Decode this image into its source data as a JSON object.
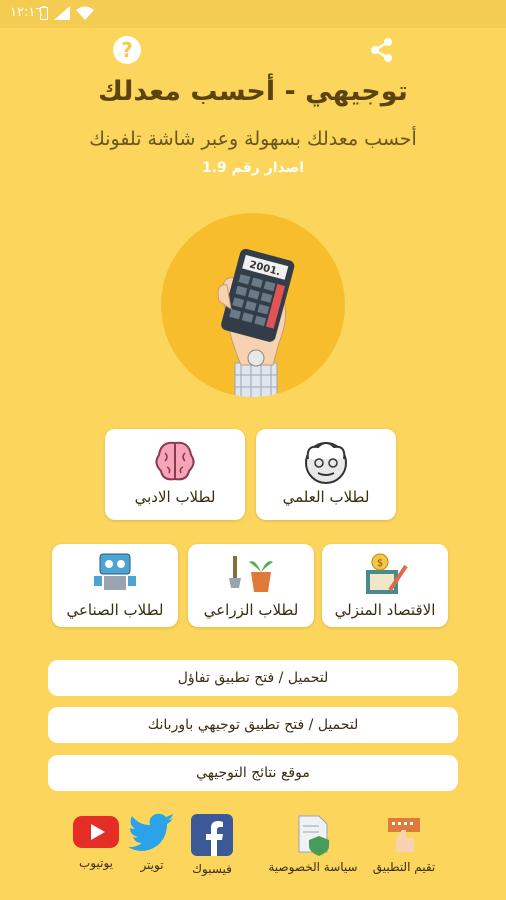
{
  "status": {
    "clock": "١٢:١٦"
  },
  "header": {
    "title": "توجيهي - أحسب معدلك",
    "subtitle": "أحسب معدلك بسهولة وعبر شاشة تلفونك",
    "version": "اصدار رقم 1.9"
  },
  "hero": {
    "display": "2001."
  },
  "branches": [
    {
      "label": "لطلاب العلمي"
    },
    {
      "label": "لطلاب الادبي"
    },
    {
      "label": "الاقتصاد المنزلي"
    },
    {
      "label": "لطلاب الزراعي"
    },
    {
      "label": "لطلاب الصناعي"
    }
  ],
  "links": [
    {
      "label": "لتحميل / فتح تطبيق تفاؤل"
    },
    {
      "label": "لتحميل / فتح تطبيق توجيهي باوربانك"
    },
    {
      "label": "موقع نتائج التوجيهي"
    }
  ],
  "footer": [
    {
      "label": "تقيم التطبيق",
      "icon": "rate-icon"
    },
    {
      "label": "سياسة الخصوصية",
      "icon": "privacy-icon"
    },
    {
      "label": "فيسبوك",
      "icon": "facebook-icon"
    },
    {
      "label": "تويتر",
      "icon": "twitter-icon"
    },
    {
      "label": "يوتيوب",
      "icon": "youtube-icon"
    }
  ]
}
